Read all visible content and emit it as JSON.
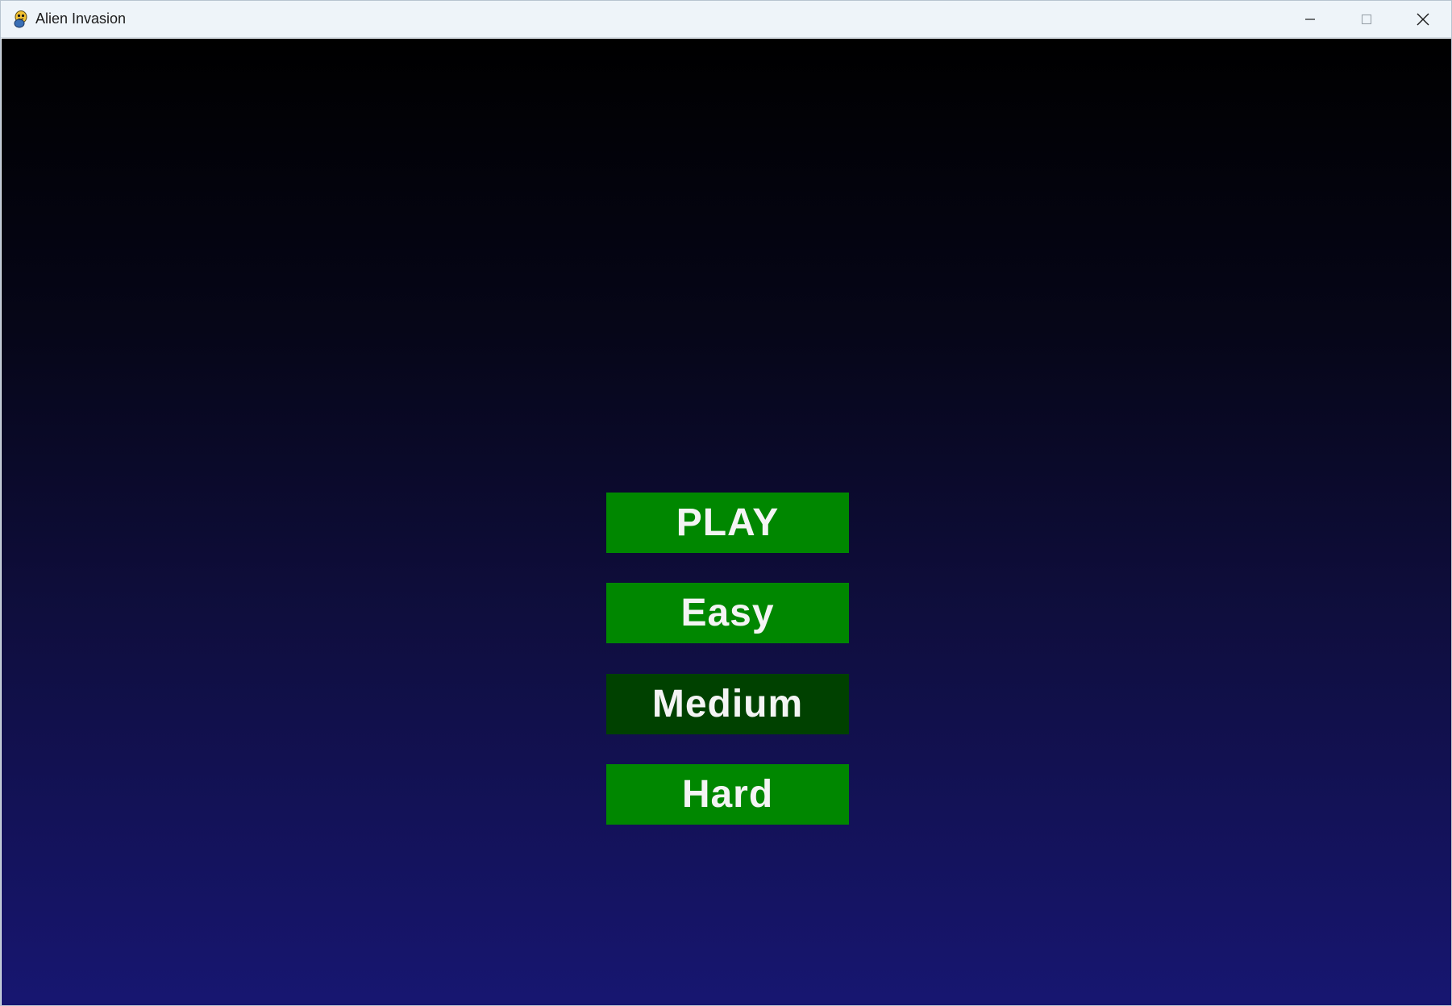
{
  "window": {
    "title": "Alien Invasion",
    "app_icon": "pygame-snake-icon",
    "controls": {
      "minimize_icon": "minimize-icon",
      "maximize_icon": "maximize-icon",
      "close_icon": "close-icon"
    }
  },
  "menu": {
    "buttons": [
      {
        "label": "PLAY",
        "color": "#008700",
        "selected": false
      },
      {
        "label": "Easy",
        "color": "#008700",
        "selected": false
      },
      {
        "label": "Medium",
        "color": "#004100",
        "selected": true
      },
      {
        "label": "Hard",
        "color": "#008700",
        "selected": false
      }
    ]
  },
  "colors": {
    "background_top": "#000000",
    "background_bottom": "#171671",
    "button_text": "#f4f4f4"
  }
}
